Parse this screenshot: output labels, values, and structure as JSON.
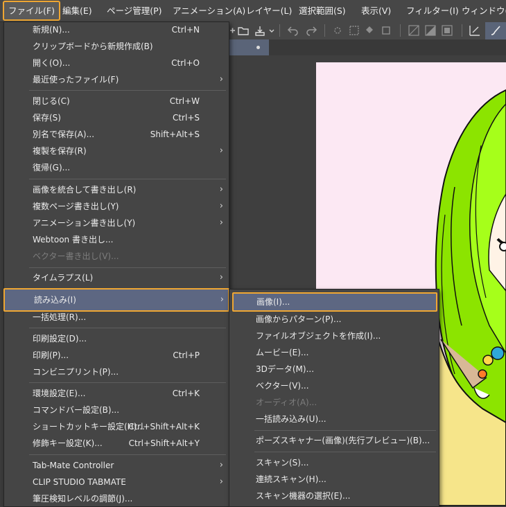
{
  "menubar": {
    "items": [
      {
        "label": "ファイル(F)"
      },
      {
        "label": "編集(E)"
      },
      {
        "label": "ページ管理(P)"
      },
      {
        "label": "アニメーション(A)"
      },
      {
        "label": "レイヤー(L)"
      },
      {
        "label": "選択範囲(S)"
      },
      {
        "label": "表示(V)"
      },
      {
        "label": "フィルター(I)"
      },
      {
        "label": "ウィンドウ(W"
      }
    ]
  },
  "file_menu": {
    "items": [
      {
        "label": "新規(N)...",
        "shortcut": "Ctrl+N"
      },
      {
        "label": "クリップボードから新規作成(B)",
        "shortcut": ""
      },
      {
        "label": "開く(O)...",
        "shortcut": "Ctrl+O"
      },
      {
        "label": "最近使ったファイル(F)",
        "shortcut": ""
      },
      {
        "label": "閉じる(C)",
        "shortcut": "Ctrl+W"
      },
      {
        "label": "保存(S)",
        "shortcut": "Ctrl+S"
      },
      {
        "label": "別名で保存(A)...",
        "shortcut": "Shift+Alt+S"
      },
      {
        "label": "複製を保存(R)",
        "shortcut": ""
      },
      {
        "label": "復帰(G)...",
        "shortcut": ""
      },
      {
        "label": "画像を統合して書き出し(R)",
        "shortcut": ""
      },
      {
        "label": "複数ページ書き出し(Y)",
        "shortcut": ""
      },
      {
        "label": "アニメーション書き出し(Y)",
        "shortcut": ""
      },
      {
        "label": "Webtoon 書き出し...",
        "shortcut": ""
      },
      {
        "label": "ベクター書き出し(V)...",
        "shortcut": ""
      },
      {
        "label": "タイムラプス(L)",
        "shortcut": ""
      },
      {
        "label": "読み込み(I)",
        "shortcut": ""
      },
      {
        "label": "一括処理(R)...",
        "shortcut": ""
      },
      {
        "label": "印刷設定(D)...",
        "shortcut": ""
      },
      {
        "label": "印刷(P)...",
        "shortcut": "Ctrl+P"
      },
      {
        "label": "コンビニプリント(P)...",
        "shortcut": ""
      },
      {
        "label": "環境設定(E)...",
        "shortcut": "Ctrl+K"
      },
      {
        "label": "コマンドバー設定(B)...",
        "shortcut": ""
      },
      {
        "label": "ショートカットキー設定(H)...",
        "shortcut": "Ctrl+Shift+Alt+K"
      },
      {
        "label": "修飾キー設定(K)...",
        "shortcut": "Ctrl+Shift+Alt+Y"
      },
      {
        "label": "Tab-Mate Controller",
        "shortcut": ""
      },
      {
        "label": "CLIP STUDIO TABMATE",
        "shortcut": ""
      },
      {
        "label": "筆圧検知レベルの調節(J)...",
        "shortcut": ""
      }
    ],
    "submenu_arrow": "›"
  },
  "import_submenu": {
    "items": [
      {
        "label": "画像(I)..."
      },
      {
        "label": "画像からパターン(P)..."
      },
      {
        "label": "ファイルオブジェクトを作成(I)..."
      },
      {
        "label": "ムービー(E)..."
      },
      {
        "label": "3Dデータ(M)..."
      },
      {
        "label": "ベクター(V)..."
      },
      {
        "label": "オーディオ(A)..."
      },
      {
        "label": "一括読み込み(U)..."
      },
      {
        "label": "ポーズスキャナー(画像)(先行プレビュー)(B)..."
      },
      {
        "label": "スキャン(S)..."
      },
      {
        "label": "連続スキャン(H)..."
      },
      {
        "label": "スキャン機器の選択(E)..."
      }
    ]
  },
  "theme": {
    "highlight_border": "#f0a732",
    "highlight_fill": "#5d6782",
    "menu_bg": "#454545",
    "paper_color": "#fce8f3",
    "hair_color": "#7fe000"
  },
  "toolbar": {
    "icons": [
      "add-icon",
      "open-folder-icon",
      "save-icon",
      "undo-icon",
      "redo-icon",
      "brightness-icon",
      "transform-icon",
      "fill-icon",
      "crop-icon",
      "hatch-icon",
      "ruler-icon",
      "frame-icon",
      "pen-icon",
      "brush-icon"
    ]
  }
}
